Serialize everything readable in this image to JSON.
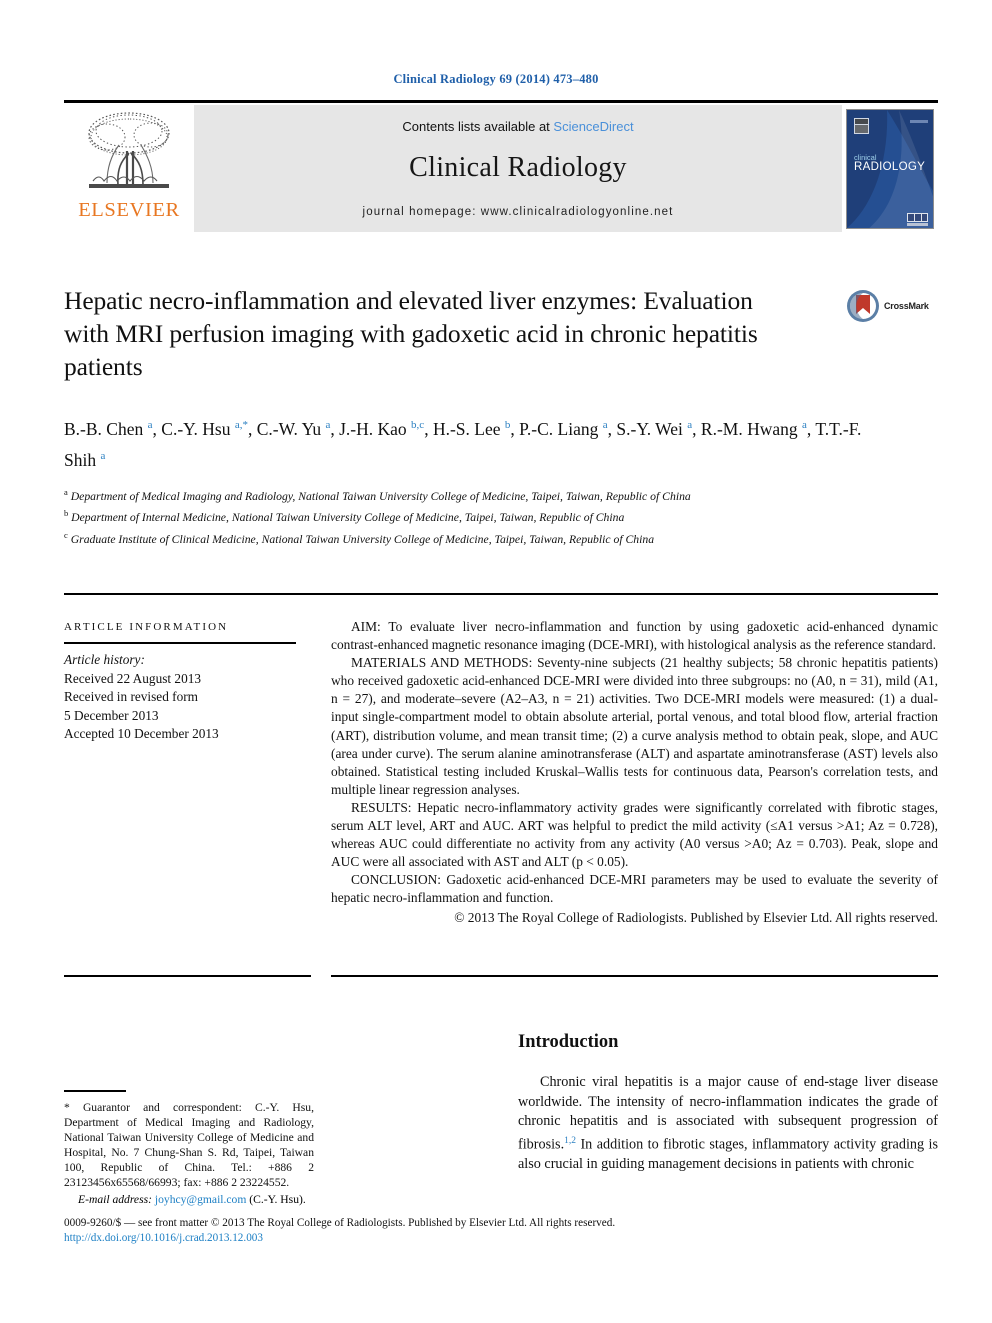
{
  "running_head": "Clinical Radiology 69 (2014) 473–480",
  "masthead": {
    "publisher_logo_text": "ELSEVIER",
    "contents_prefix": "Contents lists available at ",
    "contents_link": "ScienceDirect",
    "journal_name": "Clinical Radiology",
    "homepage": "journal homepage: www.clinicalradiologyonline.net",
    "cover_title_line1": "clinical",
    "cover_title_line2": "RADIOLOGY",
    "colors": {
      "elsevier_orange": "#E87722",
      "link_blue": "#4a90d9",
      "band_grey": "#e6e6e6",
      "cover_navy": "#1f3f79"
    }
  },
  "article": {
    "title": "Hepatic necro-inflammation and elevated liver enzymes: Evaluation with MRI perfusion imaging with gadoxetic acid in chronic hepatitis patients",
    "crossmark_label": "CrossMark",
    "authors_html": "B.-B. Chen <sup>a</sup>, C.-Y. Hsu <sup>a,<span class=\"star\">*</span></sup>, C.-W. Yu <sup>a</sup>, J.-H. Kao <sup>b,c</sup>, H.-S. Lee <sup>b</sup>, P.-C. Liang <sup>a</sup>, S.-Y. Wei <sup>a</sup>, R.-M. Hwang <sup>a</sup>, T.T.-F. Shih <sup>a</sup>",
    "affiliations": [
      {
        "marker": "a",
        "text": "Department of Medical Imaging and Radiology, National Taiwan University College of Medicine, Taipei, Taiwan, Republic of China"
      },
      {
        "marker": "b",
        "text": "Department of Internal Medicine, National Taiwan University College of Medicine, Taipei, Taiwan, Republic of China"
      },
      {
        "marker": "c",
        "text": "Graduate Institute of Clinical Medicine, National Taiwan University College of Medicine, Taipei, Taiwan, Republic of China"
      }
    ]
  },
  "article_information": {
    "heading": "ARTICLE INFORMATION",
    "history_label": "Article history:",
    "history_lines": [
      "Received 22 August 2013",
      "Received in revised form",
      "5 December 2013",
      "Accepted 10 December 2013"
    ]
  },
  "abstract": {
    "aim_label": "AIM:",
    "aim_text": " To evaluate liver necro-inflammation and function by using gadoxetic acid-enhanced dynamic contrast-enhanced magnetic resonance imaging (DCE-MRI), with histological analysis as the reference standard.",
    "methods_label": "MATERIALS AND METHODS:",
    "methods_text": " Seventy-nine subjects (21 healthy subjects; 58 chronic hepatitis patients) who received gadoxetic acid-enhanced DCE-MRI were divided into three subgroups: no (A0, n = 31), mild (A1, n = 27), and moderate–severe (A2–A3, n = 21) activities. Two DCE-MRI models were measured: (1) a dual-input single-compartment model to obtain absolute arterial, portal venous, and total blood flow, arterial fraction (ART), distribution volume, and mean transit time; (2) a curve analysis method to obtain peak, slope, and AUC (area under curve). The serum alanine aminotransferase (ALT) and aspartate aminotransferase (AST) levels also obtained. Statistical testing included Kruskal–Wallis tests for continuous data, Pearson's correlation tests, and multiple linear regression analyses.",
    "results_label": "RESULTS:",
    "results_text": " Hepatic necro-inflammatory activity grades were significantly correlated with fibrotic stages, serum ALT level, ART and AUC. ART was helpful to predict the mild activity (≤A1 versus >A1; Az = 0.728), whereas AUC could differentiate no activity from any activity (A0 versus >A0; Az = 0.703). Peak, slope and AUC were all associated with AST and ALT (p < 0.05).",
    "conclusion_label": "CONCLUSION:",
    "conclusion_text": " Gadoxetic acid-enhanced DCE-MRI parameters may be used to evaluate the severity of hepatic necro-inflammation and function.",
    "copyright": "© 2013 The Royal College of Radiologists. Published by Elsevier Ltd. All rights reserved."
  },
  "correspondence": {
    "note": "* Guarantor and correspondent: C.-Y. Hsu, Department of Medical Imaging and Radiology, National Taiwan University College of Medicine and Hospital, No. 7 Chung-Shan S. Rd, Taipei, Taiwan 100, Republic of China. Tel.: +886 2 23123456x65568/66993; fax: +886 2 23224552.",
    "email_label": "E-mail address:",
    "email": "joyhcy@gmail.com",
    "email_owner": "(C.-Y. Hsu)."
  },
  "introduction": {
    "heading": "Introduction",
    "paragraph_pre": "Chronic viral hepatitis is a major cause of end-stage liver disease worldwide. The intensity of necro-inflammation indicates the grade of chronic hepatitis and is associated with subsequent progression of fibrosis.",
    "citation": "1,2",
    "paragraph_post": " In addition to fibrotic stages, inflammatory activity grading is also crucial in guiding management decisions in patients with chronic"
  },
  "footer": {
    "imprint": "0009-9260/$ — see front matter © 2013 The Royal College of Radiologists. Published by Elsevier Ltd. All rights reserved.",
    "doi": "http://dx.doi.org/10.1016/j.crad.2013.12.003"
  }
}
